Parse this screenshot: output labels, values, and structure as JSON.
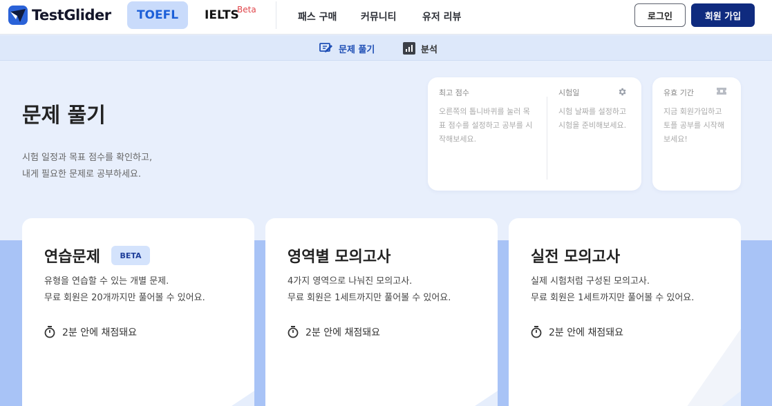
{
  "header": {
    "logo_text": "TestGlider",
    "tabs": [
      {
        "label": "TOEFL",
        "active": true
      },
      {
        "label": "IELTS",
        "badge": "Beta",
        "active": false
      }
    ],
    "nav": [
      "패스 구매",
      "커뮤니티",
      "유저 리뷰"
    ],
    "login_label": "로그인",
    "signup_label": "회원 가입"
  },
  "subnav": {
    "items": [
      {
        "label": "문제 풀기",
        "icon": "practice-icon",
        "active": true
      },
      {
        "label": "분석",
        "icon": "chart-icon",
        "active": false
      }
    ]
  },
  "hero": {
    "title": "문제 풀기",
    "desc_line1": "시험 일정과 목표 점수를 확인하고,",
    "desc_line2": "내게 필요한 문제로 공부하세요."
  },
  "info": {
    "best_score_label": "최고 점수",
    "best_score_text": [
      "오른쪽의 톱니바퀴를 눌러 목",
      "표 점수를 설정하고 공부를 시",
      "작해보세요."
    ],
    "exam_date_label": "시험일",
    "exam_date_text": [
      "시험 날짜를 설정하고",
      "시험을 준비해보세요."
    ],
    "validity_label": "유효 기간",
    "validity_text": [
      "지금 회원가입하고",
      "토플 공부를 시작해",
      "보세요!"
    ]
  },
  "cards": [
    {
      "title": "연습문제",
      "badge": "BETA",
      "desc1": "유형을 연습할 수 있는 개별 문제.",
      "desc2": "무료 회원은 20개까지만 풀어볼 수 있어요.",
      "timing": "2분 안에 채점돼요"
    },
    {
      "title": "영역별 모의고사",
      "desc1": "4가지 영역으로 나눠진 모의고사.",
      "desc2": "무료 회원은 1세트까지만 풀어볼 수 있어요.",
      "timing": "2분 안에 채점돼요"
    },
    {
      "title": "실전 모의고사",
      "desc1": "실제 시험처럼 구성된 모의고사.",
      "desc2": "무료 회원은 1세트까지만 풀어볼 수 있어요.",
      "timing": "2분 안에 채점돼요"
    }
  ],
  "colors": {
    "brand": "#1c5fd8",
    "signup": "#0f2b7f",
    "beta_red": "#e0454a",
    "page_bg": "#e8effc",
    "lower_bg": "#a8c3f6"
  }
}
